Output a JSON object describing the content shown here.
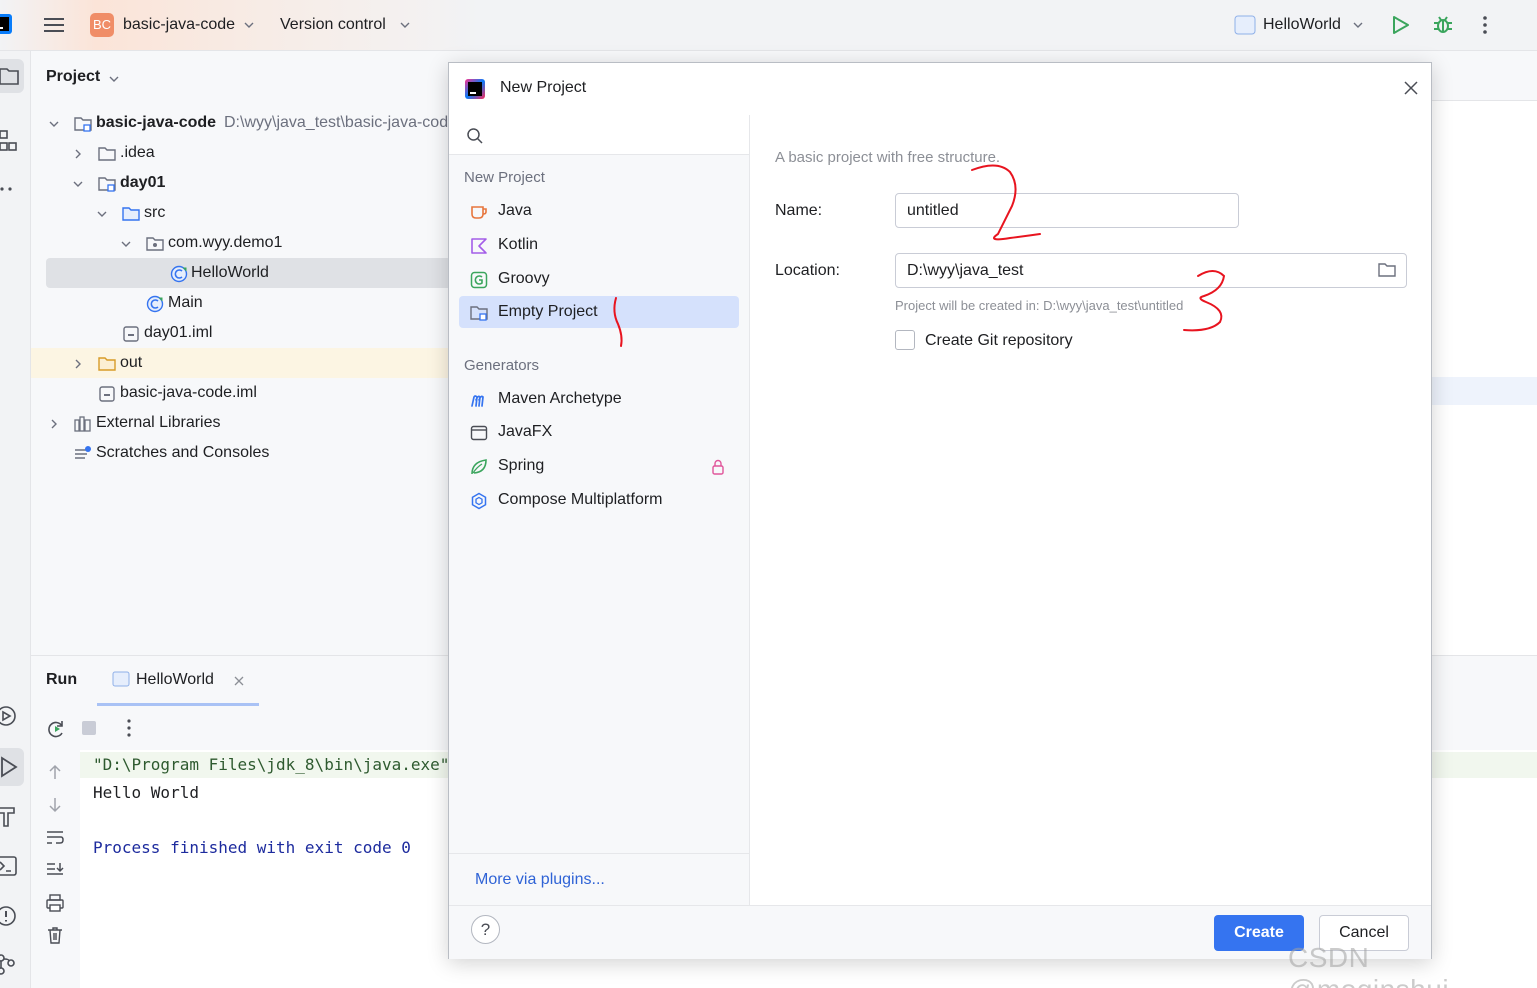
{
  "topbar": {
    "project_badge": "BC",
    "project_name": "basic-java-code",
    "vcs_label": "Version control",
    "run_config": "HelloWorld"
  },
  "project_pane": {
    "title": "Project",
    "tree": {
      "root_name": "basic-java-code",
      "root_path": "D:\\wyy\\java_test\\basic-java-code",
      "idea": ".idea",
      "day01": "day01",
      "src": "src",
      "package": "com.wyy.demo1",
      "helloworld": "HelloWorld",
      "main": "Main",
      "day01_iml": "day01.iml",
      "out": "out",
      "root_iml": "basic-java-code.iml",
      "external_libraries": "External Libraries",
      "scratches": "Scratches and Consoles"
    }
  },
  "run_panel": {
    "title": "Run",
    "tab_label": "HelloWorld",
    "console": {
      "line1": "\"D:\\Program Files\\jdk_8\\bin\\java.exe\"",
      "line2": "Hello World",
      "line3": "Process finished with exit code 0"
    }
  },
  "dialog": {
    "title": "New Project",
    "search_placeholder": "",
    "section_new_project": "New Project",
    "items": [
      {
        "label": "Java",
        "icon": "java-cup-icon"
      },
      {
        "label": "Kotlin",
        "icon": "kotlin-icon"
      },
      {
        "label": "Groovy",
        "icon": "groovy-icon"
      },
      {
        "label": "Empty Project",
        "icon": "empty-project-icon"
      }
    ],
    "section_generators": "Generators",
    "generators": [
      {
        "label": "Maven Archetype",
        "icon": "maven-icon"
      },
      {
        "label": "JavaFX",
        "icon": "javafx-window-icon"
      },
      {
        "label": "Spring",
        "icon": "spring-leaf-icon"
      },
      {
        "label": "Compose Multiplatform",
        "icon": "compose-icon"
      }
    ],
    "more_plugins": "More via plugins...",
    "description": "A basic project with free structure.",
    "name_label": "Name:",
    "name_value": "untitled",
    "location_label": "Location:",
    "location_value": "D:\\wyy\\java_test",
    "location_hint": "Project will be created in: D:\\wyy\\java_test\\untitled",
    "git_label": "Create Git repository",
    "git_checked": false,
    "create_label": "Create",
    "cancel_label": "Cancel",
    "help_label": "?"
  },
  "watermark": "CSDN @moqinshui",
  "colors": {
    "accent": "#3574f0",
    "selection": "#d5e1fc",
    "annotation": "#e8141f",
    "console_blue": "#1d2b9e"
  }
}
